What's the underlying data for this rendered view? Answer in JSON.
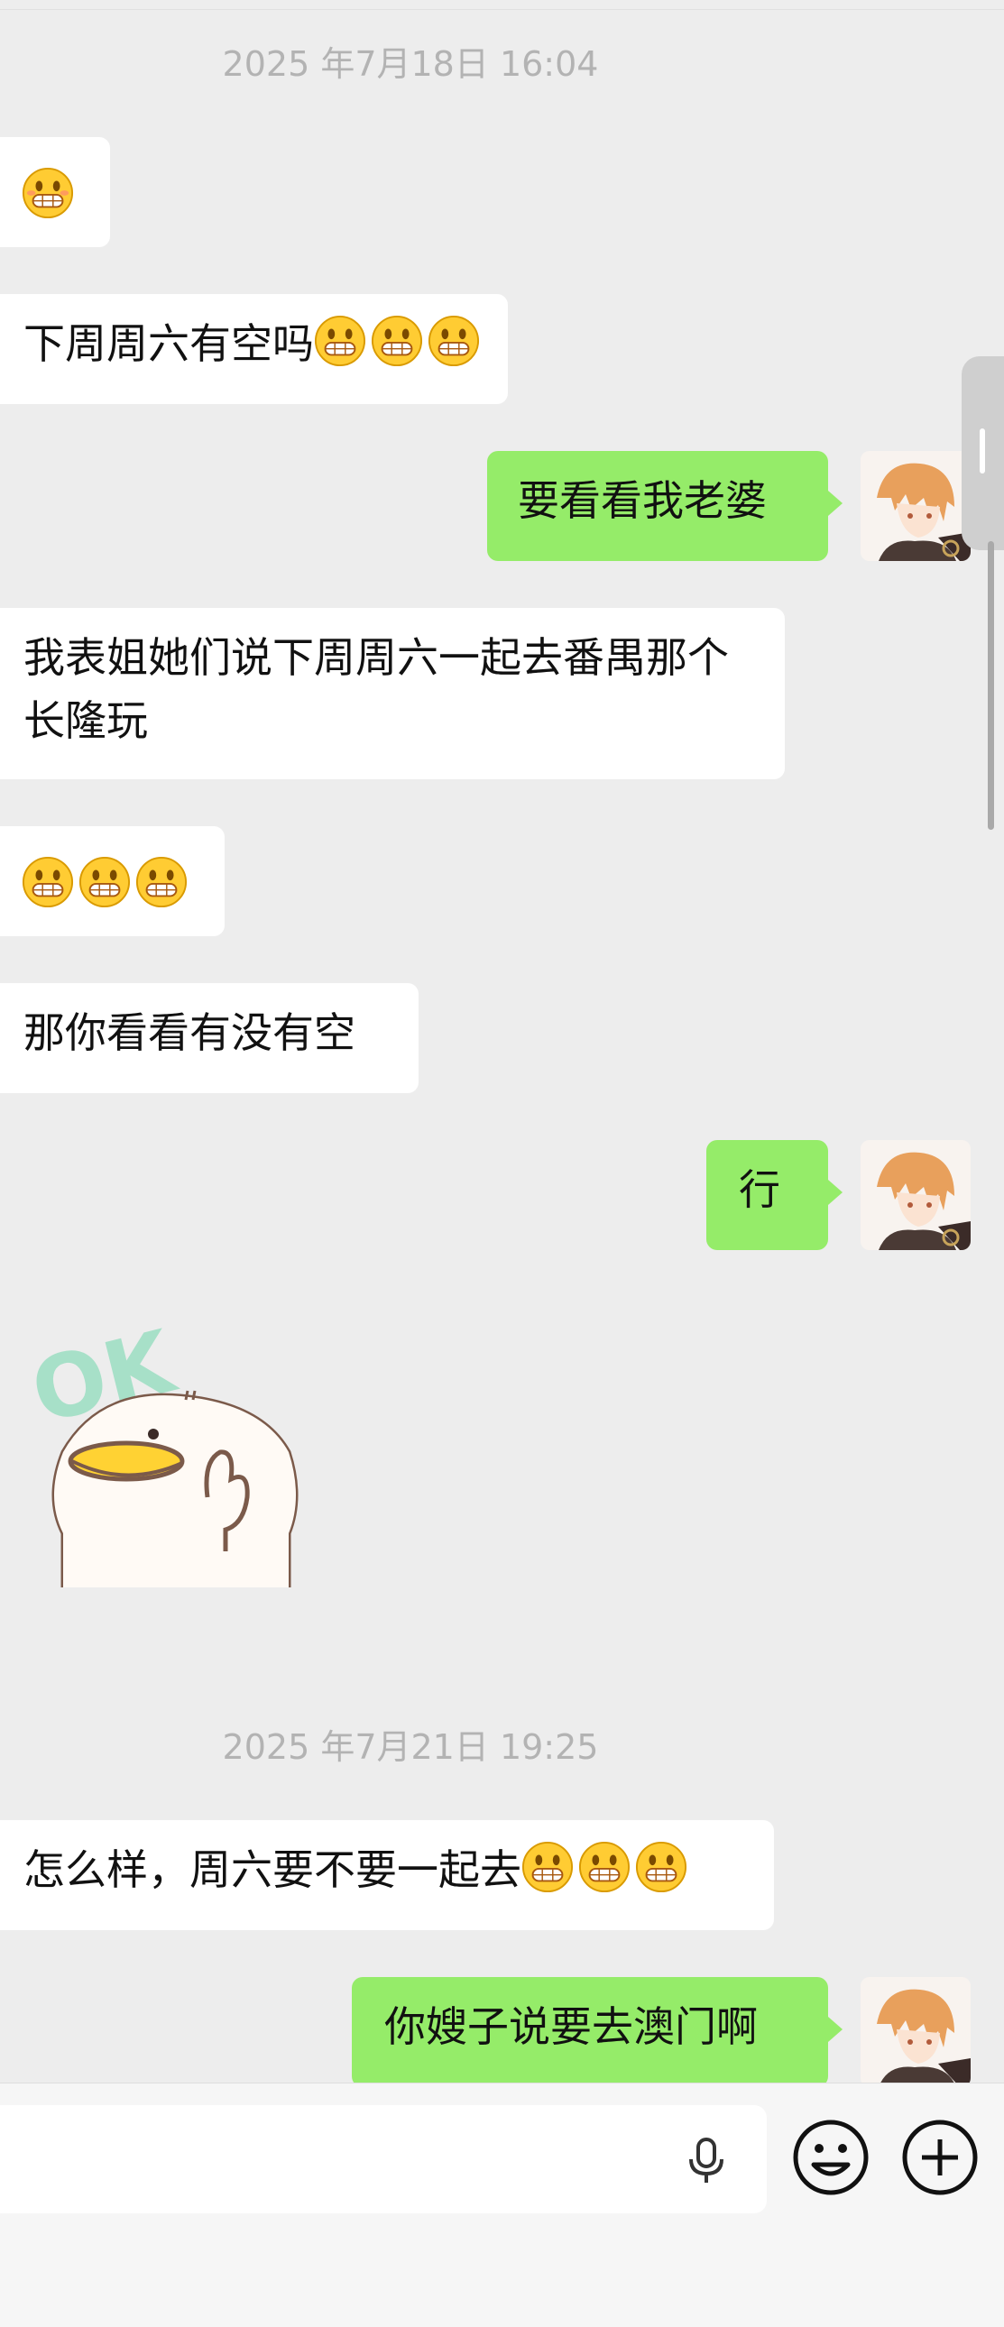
{
  "timestamps": {
    "first": "2025 年7月18日 16:04",
    "second": "2025 年7月21日 19:25"
  },
  "messages": {
    "m1": "",
    "m2_text": "下周周六有空吗",
    "m3_text": "要看看我老婆",
    "m4_text": "我表姐她们说下周周六一起去番禺那个长隆玩",
    "m6_text": "那你看看有没有空",
    "m7_text": "行",
    "m8_text": "怎么样，周六要不要一起去",
    "m9_text": "你嫂子说要去澳门啊"
  },
  "sticker": {
    "label": "OK"
  },
  "icons": {
    "grin_emoji": "grinning-face-emoji",
    "voice": "mic-icon",
    "emoji_button": "smiley-icon",
    "more_button": "plus-icon"
  },
  "colors": {
    "background": "#ededed",
    "sent_bubble": "#95ec69",
    "received_bubble": "#ffffff"
  }
}
